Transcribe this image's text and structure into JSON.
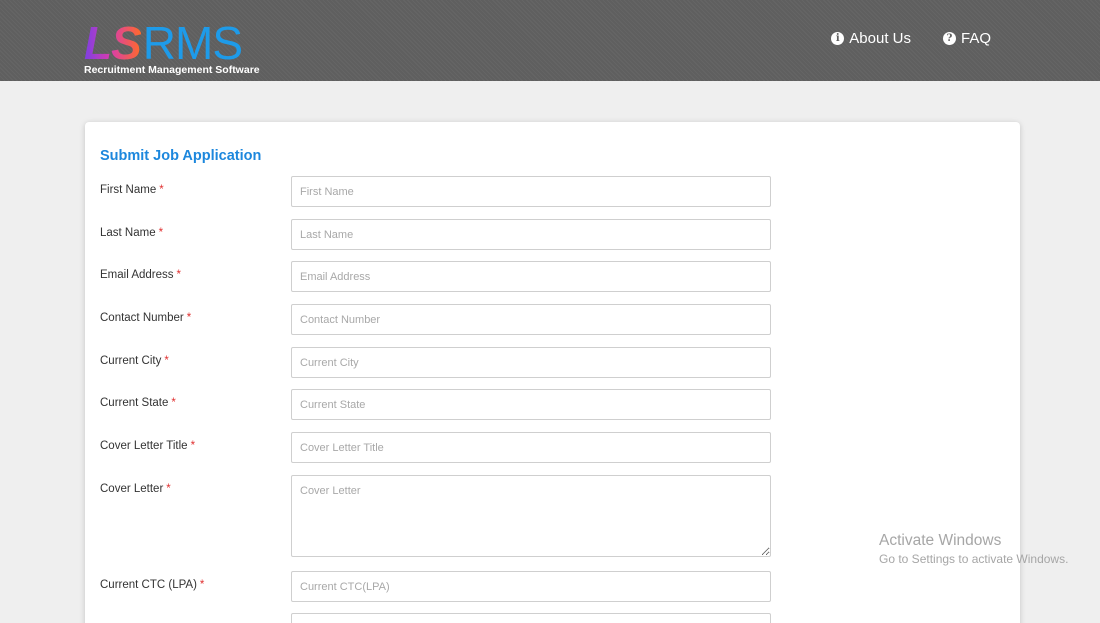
{
  "header": {
    "logo_mark_ls": "LS",
    "logo_mark_rms": "RMS",
    "logo_subtitle": "Recruitment Management Software",
    "nav": [
      {
        "label": "About Us",
        "icon": "info-circle-icon"
      },
      {
        "label": "FAQ",
        "icon": "question-circle-icon"
      }
    ]
  },
  "form": {
    "title": "Submit Job Application",
    "required_marker": "*",
    "fields": [
      {
        "label": "First Name",
        "placeholder": "First Name",
        "value": ""
      },
      {
        "label": "Last Name",
        "placeholder": "Last Name",
        "value": ""
      },
      {
        "label": "Email Address",
        "placeholder": "Email Address",
        "value": ""
      },
      {
        "label": "Contact Number",
        "placeholder": "Contact Number",
        "value": ""
      },
      {
        "label": "Current City",
        "placeholder": "Current City",
        "value": ""
      },
      {
        "label": "Current State",
        "placeholder": "Current State",
        "value": ""
      },
      {
        "label": "Cover Letter Title",
        "placeholder": "Cover Letter Title",
        "value": ""
      },
      {
        "label": "Cover Letter",
        "placeholder": "Cover Letter",
        "value": ""
      },
      {
        "label": "Current CTC (LPA)",
        "placeholder": "Current CTC(LPA)",
        "value": ""
      },
      {
        "label": "",
        "placeholder": "",
        "value": ""
      }
    ]
  },
  "watermark": {
    "title": "Activate Windows",
    "subtitle": "Go to Settings to activate Windows."
  },
  "colors": {
    "header_bg": "#5f5f5f",
    "page_bg": "#efefef",
    "title_blue": "#1c87dd",
    "logo_blue": "#1e9be9",
    "required_red": "#e03030"
  }
}
